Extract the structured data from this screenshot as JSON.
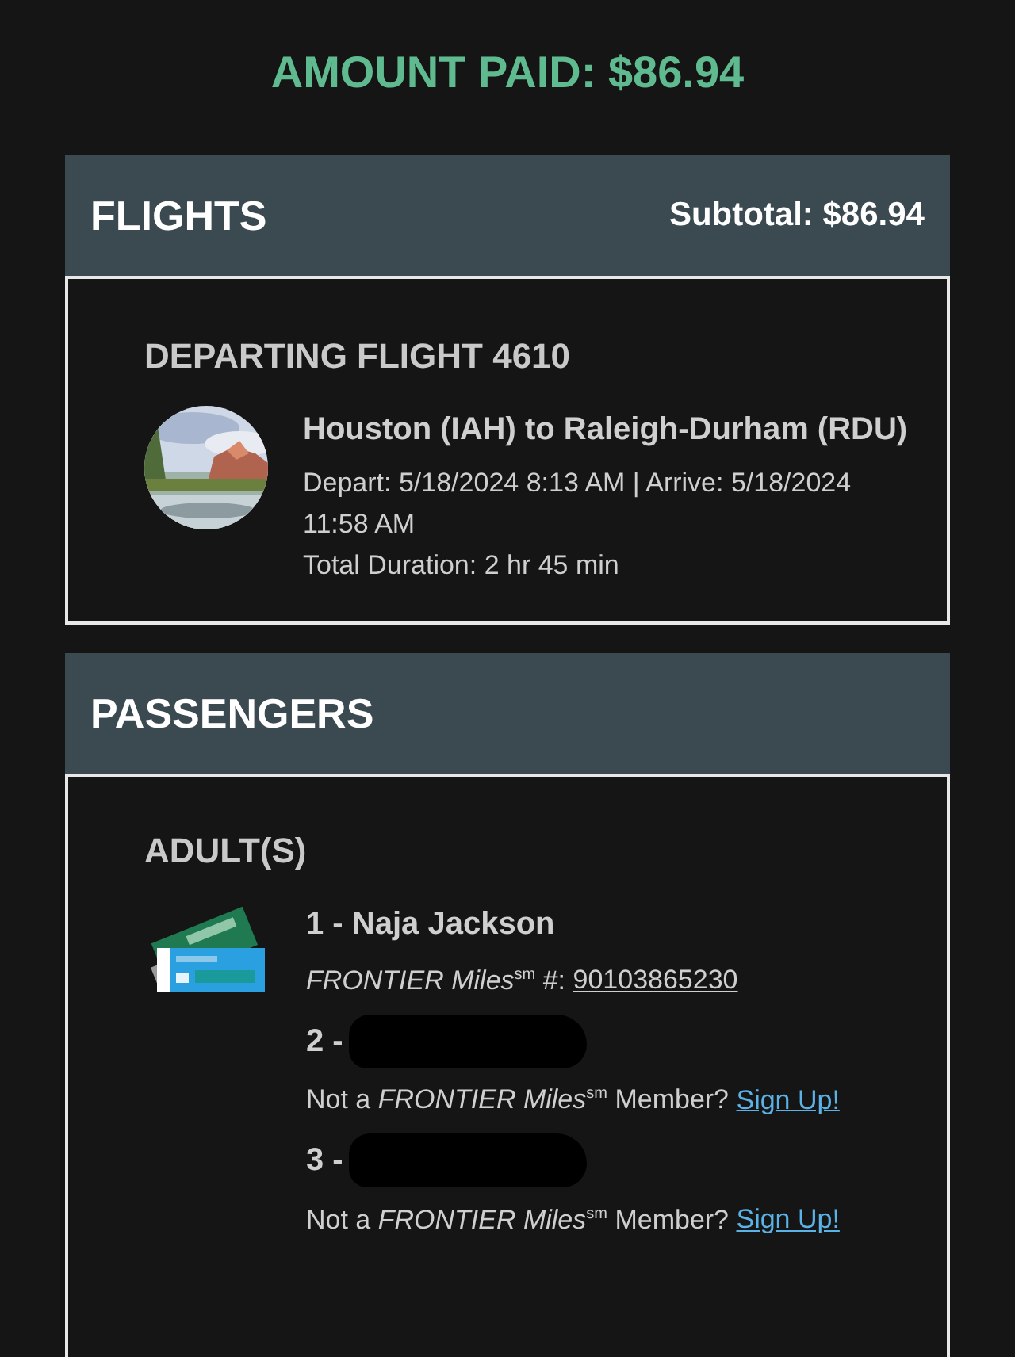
{
  "amount_paid": "AMOUNT PAID: $86.94",
  "flights": {
    "title": "FLIGHTS",
    "subtotal": "Subtotal: $86.94",
    "flight": {
      "heading": "DEPARTING FLIGHT 4610",
      "route": "Houston (IAH) to Raleigh-Durham (RDU)",
      "times": "Depart: 5/18/2024 8:13 AM | Arrive: 5/18/2024 11:58 AM",
      "duration": "Total Duration: 2 hr 45 min"
    }
  },
  "passengers": {
    "title": "PASSENGERS",
    "group": "ADULT(S)",
    "items": [
      {
        "kind": "member",
        "name": "1 - Naja Jackson",
        "redacted": false,
        "program": "*FRONTIER Miles*$^{sm}$ #: ",
        "number": "90103865230"
      },
      {
        "kind": "guest",
        "name": "2 -",
        "redacted": true,
        "prompt": "Not a *FRONTIER Miles*$^{sm}$ Member? ",
        "link": "Sign Up!"
      },
      {
        "kind": "guest",
        "name": "3 -",
        "redacted": true,
        "prompt": "Not a *FRONTIER Miles*$^{sm}$ Member? ",
        "link": "Sign Up!"
      }
    ]
  }
}
